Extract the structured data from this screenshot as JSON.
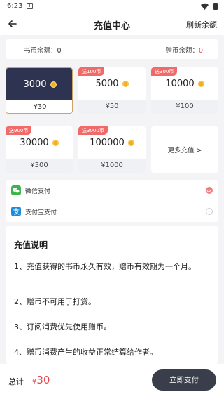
{
  "status_bar": {
    "time": "6:23",
    "notif_icon": "!"
  },
  "header": {
    "title": "充值中心",
    "refresh_label": "刷新余额"
  },
  "balance": {
    "coin_label": "书币余额：",
    "coin_value": "0",
    "gift_label": "赠币余额：",
    "gift_value": "0"
  },
  "packages": [
    {
      "amount": "3000",
      "price": "¥30",
      "badge": "",
      "selected": true
    },
    {
      "amount": "5000",
      "price": "¥50",
      "badge": "送100币",
      "selected": false
    },
    {
      "amount": "10000",
      "price": "¥100",
      "badge": "送300币",
      "selected": false
    },
    {
      "amount": "30000",
      "price": "¥300",
      "badge": "送900币",
      "selected": false
    },
    {
      "amount": "100000",
      "price": "¥1000",
      "badge": "送3000币",
      "selected": false
    }
  ],
  "more_label": "更多充值 >",
  "payment": {
    "wechat": "微信支付",
    "alipay": "支付宝支付",
    "selected": "wechat"
  },
  "notes": {
    "title": "充值说明",
    "items": [
      "1、充值获得的书币永久有效，赠币有效期为一个月。",
      "2、赠币不可用于打赏。",
      "3、订阅消费优先使用赠币。",
      "4、赠币消费产生的收益正常结算给作者。"
    ]
  },
  "footer": {
    "total_label": "总计",
    "currency": "¥",
    "total_amount": "30",
    "pay_label": "立即支付"
  },
  "colors": {
    "accent_red": "#e8474a",
    "badge_red": "#f06a6a",
    "selected_card": "#2d3350",
    "pay_button": "#3a3d4a",
    "wechat_green": "#3bb54a",
    "alipay_blue": "#1a8ce0"
  }
}
